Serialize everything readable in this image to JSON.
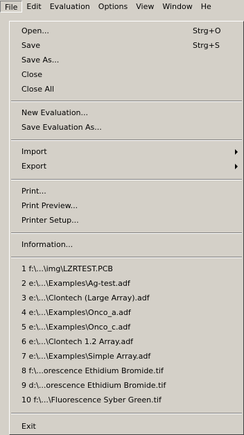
{
  "menubar": {
    "items": [
      "File",
      "Edit",
      "Evaluation",
      "Options",
      "View",
      "Window",
      "He"
    ]
  },
  "file_menu": {
    "open": {
      "label": "Open...",
      "shortcut": "Strg+O"
    },
    "save": {
      "label": "Save",
      "shortcut": "Strg+S"
    },
    "save_as": "Save As...",
    "close": "Close",
    "close_all": "Close All",
    "new_evaluation": "New Evaluation...",
    "save_evaluation_as": "Save Evaluation As...",
    "import": "Import",
    "export": "Export",
    "print": "Print...",
    "print_preview": "Print Preview...",
    "printer_setup": "Printer Setup...",
    "information": "Information...",
    "recent_files": [
      "1 f:\\...\\img\\LZRTEST.PCB",
      "2 e:\\...\\Examples\\Ag-test.adf",
      "3 e:\\...\\Clontech (Large Array).adf",
      "4 e:\\...\\Examples\\Onco_a.adf",
      "5 e:\\...\\Examples\\Onco_c.adf",
      "6 e:\\...\\Clontech 1.2 Array.adf",
      "7 e:\\...\\Examples\\Simple Array.adf",
      "8 f:\\...orescence Ethidium Bromide.tif",
      "9 d:\\...orescence Ethidium Bromide.tif",
      "10 f:\\...\\Fluorescence Syber Green.tif"
    ],
    "exit": "Exit"
  }
}
